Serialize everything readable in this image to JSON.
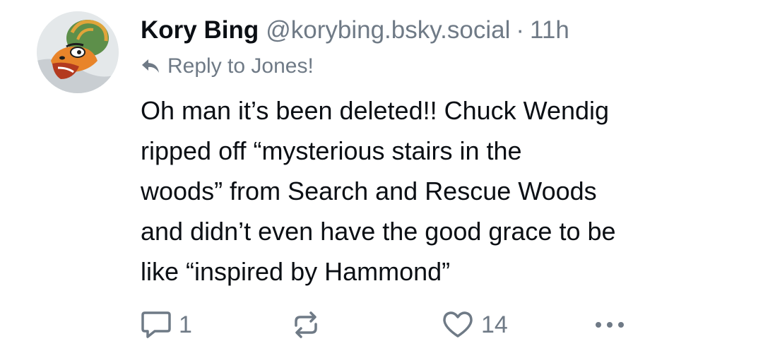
{
  "post": {
    "author": {
      "display_name": "Kory Bing",
      "handle": "@korybing.bsky.social",
      "separator": "·",
      "time": "11h"
    },
    "reply_to": {
      "icon": "reply-arrow-icon",
      "label": "Reply to Jones!"
    },
    "text": "Oh man it’s been deleted!! Chuck Wendig\nripped off “mysterious stairs in the\nwoods” from Search and Rescue Woods\nand didn’t even have the good grace to be\nlike “inspired by Hammond”",
    "actions": {
      "reply": {
        "icon": "comment-icon",
        "count": "1"
      },
      "repost": {
        "icon": "repost-icon"
      },
      "like": {
        "icon": "heart-icon",
        "count": "14"
      },
      "more": {
        "icon": "ellipsis-icon"
      }
    }
  },
  "colors": {
    "text": "#0b0f14",
    "muted": "#6f7a86",
    "background": "#ffffff"
  }
}
